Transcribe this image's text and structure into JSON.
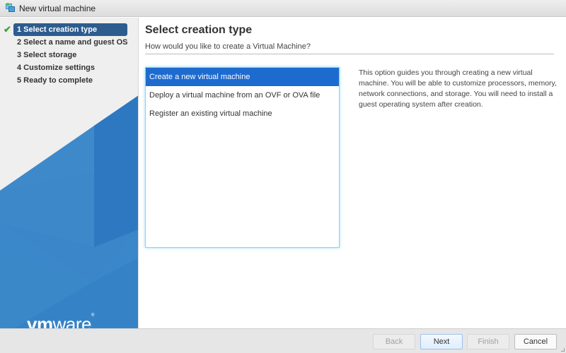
{
  "window": {
    "title": "New virtual machine",
    "icon": "virtual-machine-icon"
  },
  "sidebar": {
    "steps": [
      {
        "label": "1 Select creation type",
        "active": true,
        "completed_icon": "checkmark-icon"
      },
      {
        "label": "2 Select a name and guest OS",
        "active": false
      },
      {
        "label": "3 Select storage",
        "active": false
      },
      {
        "label": "4 Customize settings",
        "active": false
      },
      {
        "label": "5 Ready to complete",
        "active": false
      }
    ],
    "check_glyph": "✔",
    "logo": {
      "bold": "vm",
      "light": "ware",
      "mark": "®"
    }
  },
  "main": {
    "title": "Select creation type",
    "subtitle": "How would you like to create a Virtual Machine?",
    "options": [
      {
        "label": "Create a new virtual machine",
        "selected": true
      },
      {
        "label": "Deploy a virtual machine from an OVF or OVA file",
        "selected": false
      },
      {
        "label": "Register an existing virtual machine",
        "selected": false
      }
    ],
    "description": "This option guides you through creating a new virtual machine. You will be able to customize processors, memory, network connections, and storage. You will need to install a guest operating system after creation."
  },
  "footer": {
    "back_label": "Back",
    "next_label": "Next",
    "finish_label": "Finish",
    "cancel_label": "Cancel"
  },
  "colors": {
    "active_step_bg": "#2d5d8f",
    "selected_option_bg": "#1e6bd0",
    "check": "#3fa535",
    "brand_blue": "#2f7cc4"
  }
}
